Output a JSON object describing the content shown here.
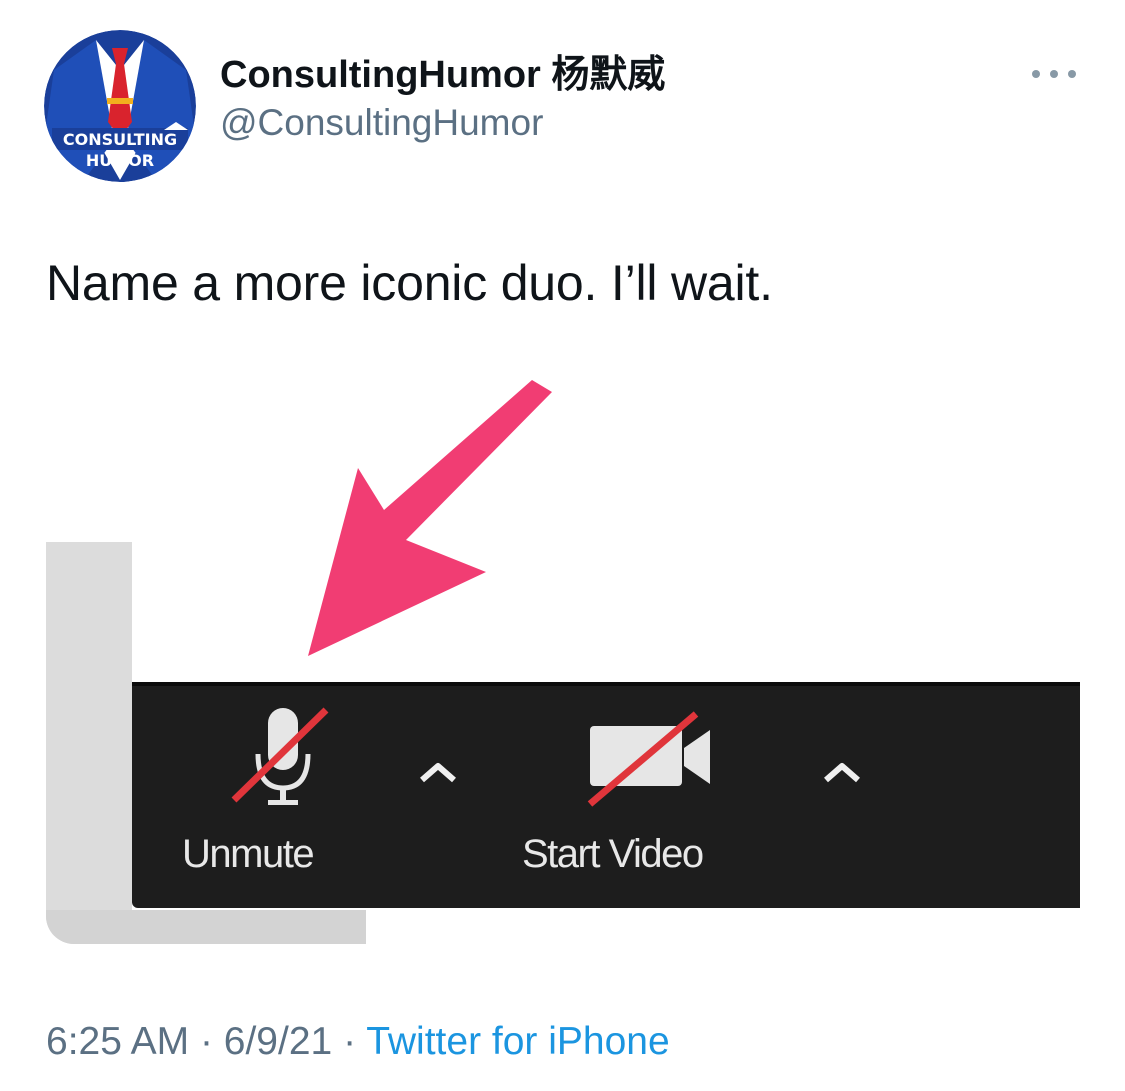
{
  "author": {
    "display_name": "ConsultingHumor 杨默威",
    "handle": "@ConsultingHumor",
    "avatar_text_line1": "CONSULTING",
    "avatar_text_line2": "HUMOR"
  },
  "tweet": {
    "text": "Name a more iconic duo. I’ll wait."
  },
  "media": {
    "toolbar": {
      "unmute_label": "Unmute",
      "video_label": "Start Video"
    }
  },
  "meta": {
    "time": "6:25 AM",
    "separator": "·",
    "date": "6/9/21",
    "source": "Twitter for iPhone"
  },
  "colors": {
    "link": "#1b95e0",
    "secondary_text": "#5b7083",
    "arrow": "#f0336b",
    "mute_slash": "#e0353b",
    "toolbar_bg": "#1d1d1d"
  }
}
